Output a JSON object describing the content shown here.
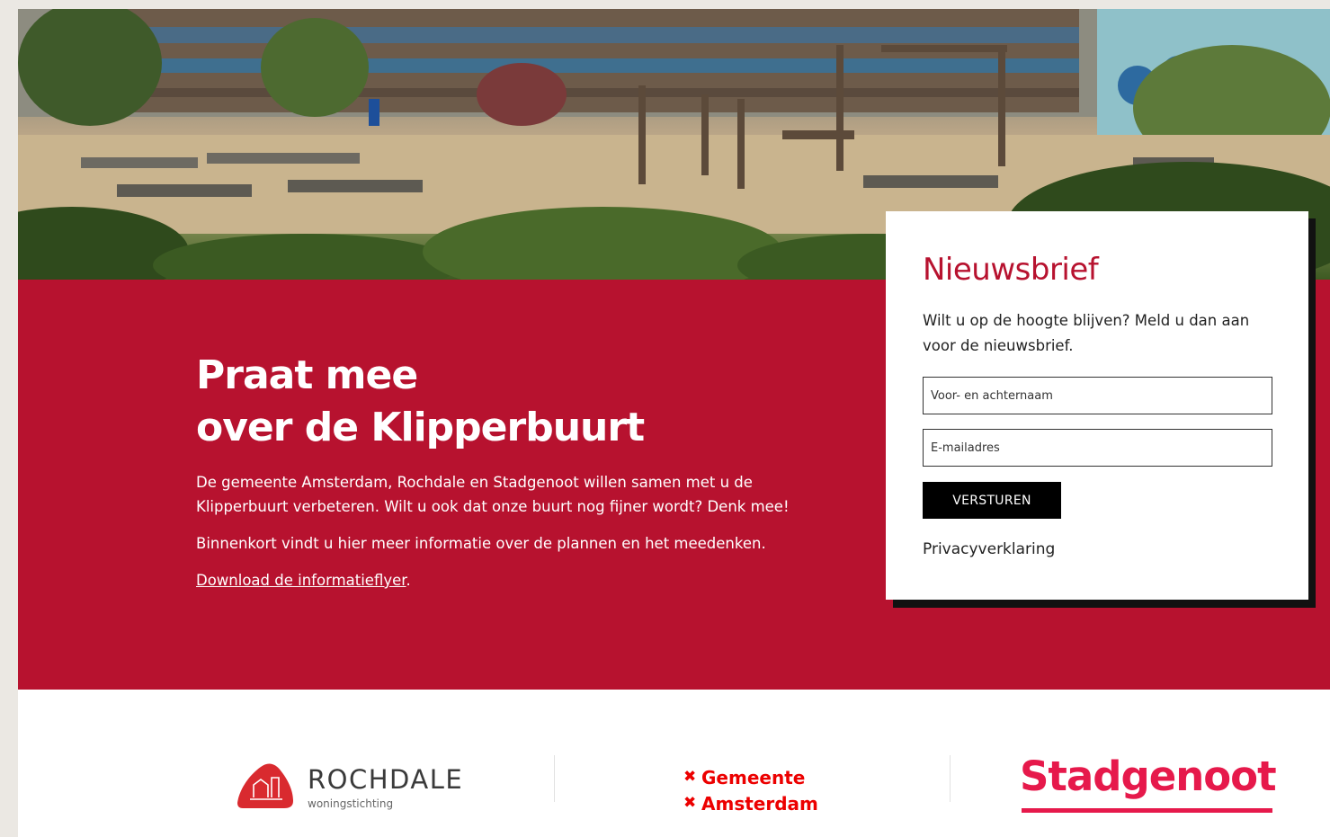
{
  "hero": {
    "alt": "Klipperbuurt playground"
  },
  "intro": {
    "title_line1": "Praat mee",
    "title_line2": "over de Klipperbuurt",
    "paragraph1": "De gemeente Amsterdam, Rochdale en Stadgenoot willen samen met u de Klipperbuurt verbeteren. Wilt u ook dat onze buurt nog fijner wordt? Denk mee!",
    "paragraph2": "Binnenkort vindt u hier meer informatie over de plannen en het meedenken.",
    "flyer_link": "Download de informatieflyer",
    "flyer_suffix": "."
  },
  "newsletter": {
    "title": "Nieuwsbrief",
    "description": "Wilt u op de hoogte blijven? Meld u dan aan voor de nieuwsbrief.",
    "name_placeholder": "Voor- en achternaam",
    "email_placeholder": "E-mailadres",
    "submit_label": "VERSTUREN",
    "privacy_link": "Privacyverklaring"
  },
  "logos": {
    "rochdale": {
      "name": "ROCHDALE",
      "tagline": "woningstichting"
    },
    "gemeente": {
      "line1": "Gemeente",
      "line2": "Amsterdam",
      "mark": "×"
    },
    "stadgenoot": {
      "name": "Stadgenoot"
    }
  },
  "colors": {
    "brand_red": "#b7122f",
    "amsterdam_red": "#ec0000",
    "stadgenoot_pink": "#e6194b",
    "button_black": "#000000"
  }
}
